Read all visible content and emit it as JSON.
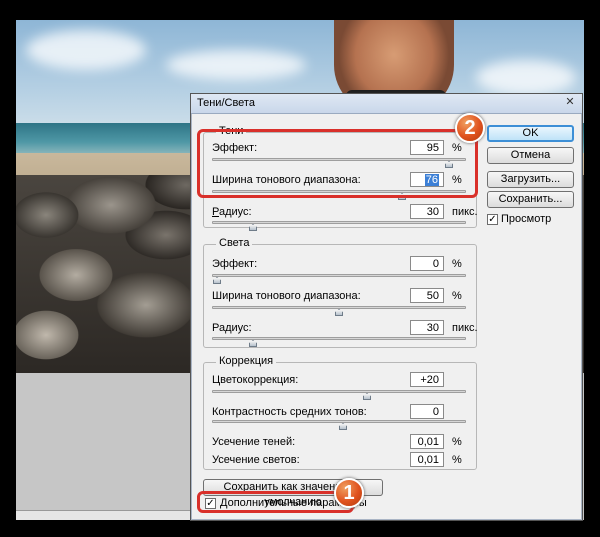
{
  "dialog": {
    "title": "Тени/Света",
    "close_glyph": "✕"
  },
  "shadows": {
    "legend": "Тени",
    "effect_label": "Эффект:",
    "effect_value": "95",
    "effect_unit": "%",
    "effect_level": 0.95,
    "width_label": "Ширина тонового диапазона:",
    "width_value": "76",
    "width_unit": "%",
    "width_level": 0.76,
    "radius_label": "Радиус:",
    "radius_value": "30",
    "radius_unit": "пикс."
  },
  "highlights": {
    "legend": "Света",
    "effect_label": "Эффект:",
    "effect_value": "0",
    "effect_unit": "%",
    "effect_level": 0.0,
    "width_label": "Ширина тонового диапазона:",
    "width_value": "50",
    "width_unit": "%",
    "width_level": 0.5,
    "radius_label": "Радиус:",
    "radius_value": "30",
    "radius_unit": "пикс."
  },
  "correction": {
    "legend": "Коррекция",
    "color_label": "Цветокоррекция:",
    "color_value": "+20",
    "midtone_label": "Контрастность средних тонов:",
    "midtone_value": "0",
    "clip_shadows_label": "Усечение теней:",
    "clip_shadows_value": "0,01",
    "clip_shadows_unit": "%",
    "clip_highlights_label": "Усечение светов:",
    "clip_highlights_value": "0,01",
    "clip_highlights_unit": "%"
  },
  "buttons": {
    "ok": "OK",
    "cancel": "Отмена",
    "load": "Загрузить...",
    "save": "Сохранить...",
    "save_defaults": "Сохранить как значения по умолчанию"
  },
  "preview": {
    "label": "Просмотр",
    "checked": true
  },
  "more_options": {
    "label": "Дополнительные параметры",
    "checked": true
  },
  "callouts": {
    "first": "1",
    "second": "2"
  },
  "colors": {
    "highlight": "#d9302a",
    "badge": "#e0521e",
    "selection": "#3b7fd6"
  }
}
